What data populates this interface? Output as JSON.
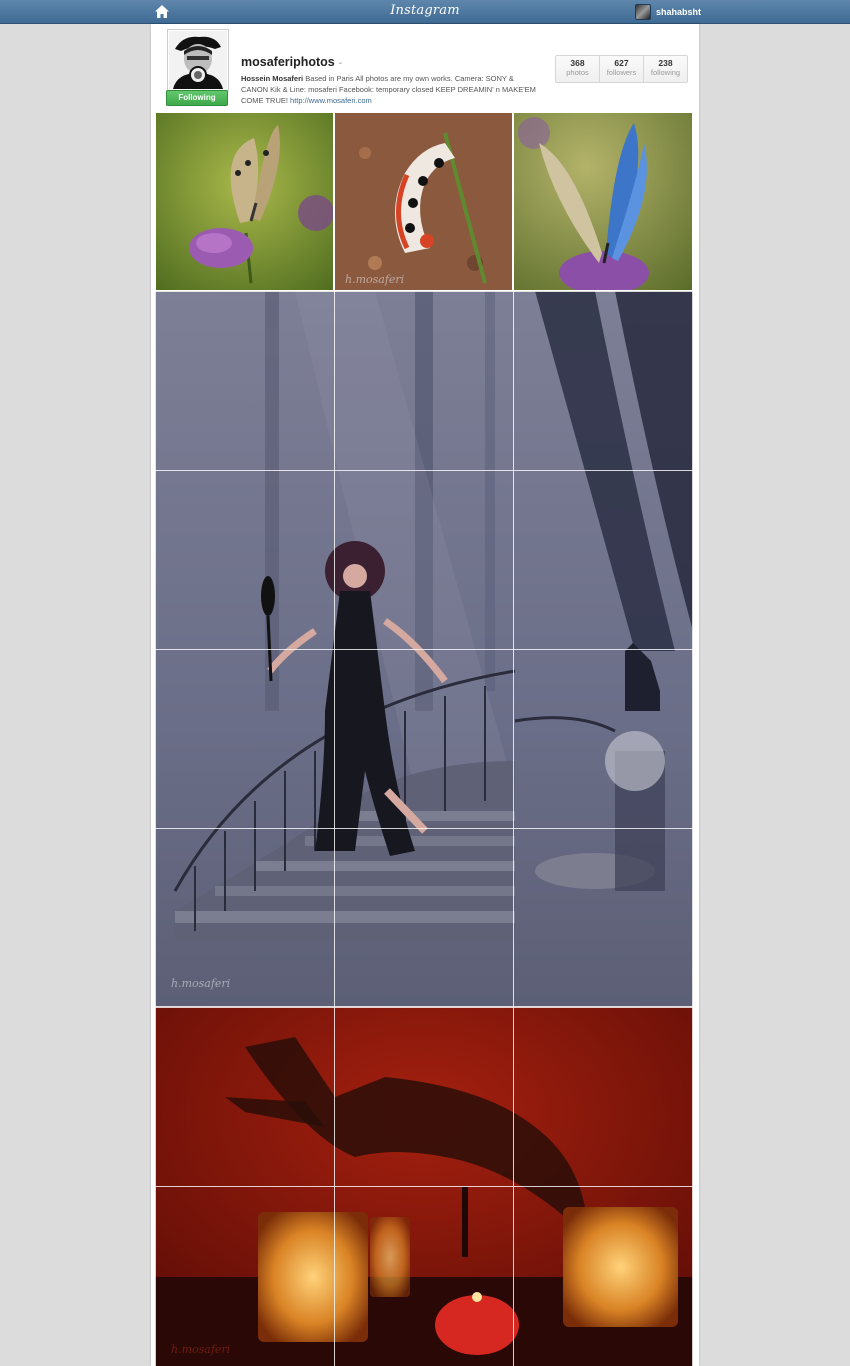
{
  "topbar": {
    "brand": "Instagram",
    "home_icon": "home-icon",
    "username": "shahabsht"
  },
  "profile": {
    "username": "mosaferiphotos",
    "username_suffix": "-",
    "follow_label": "Following",
    "bio_name": "Hossein Mosaferi",
    "bio_text": " Based in Paris All photos are my own works. Camera: SONY & CANON Kik & Line: mosaferi Facebook: temporary closed KEEP DREAMIN' n MAKE'EM COME TRUE! ",
    "bio_link": "http://www.mosaferi.com",
    "stats": [
      {
        "num": "368",
        "label": "photos"
      },
      {
        "num": "627",
        "label": "followers"
      },
      {
        "num": "238",
        "label": "following"
      }
    ]
  },
  "photos": {
    "watermark": "h.mosaferi",
    "items": [
      {
        "name": "butterfly-photo"
      },
      {
        "name": "caterpillar-photo"
      },
      {
        "name": "blue-butterfly-photo"
      },
      {
        "name": "forest-staircase-photo"
      },
      {
        "name": "candles-photo"
      }
    ]
  }
}
